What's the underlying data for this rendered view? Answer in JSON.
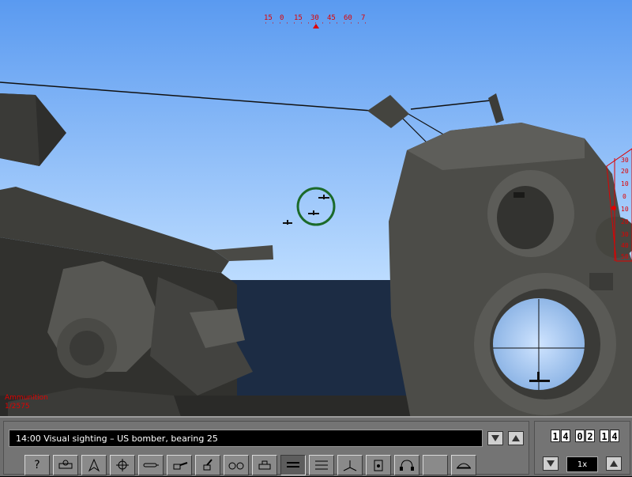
{
  "hud": {
    "compass_labels": [
      "15",
      "0",
      "15",
      "30",
      "45",
      "60",
      "7"
    ],
    "elevation_labels": [
      "30",
      "20",
      "10",
      "0",
      "10",
      "20",
      "30",
      "40",
      "50"
    ],
    "ammo_label": "Ammunition",
    "ammo_count": "1/2575"
  },
  "message_bar": {
    "text": "14:00  Visual sighting – US bomber, bearing 25"
  },
  "toolbar": {
    "items": [
      {
        "icon": "help-icon"
      },
      {
        "icon": "deck-gun-station-icon"
      },
      {
        "icon": "navigation-icon"
      },
      {
        "icon": "damage-control-icon"
      },
      {
        "icon": "torpedo-icon"
      },
      {
        "icon": "deck-gun-icon"
      },
      {
        "icon": "flak-gun-icon"
      },
      {
        "icon": "binoculars-icon"
      },
      {
        "icon": "bridge-icon"
      },
      {
        "icon": "periscope-station-icon"
      },
      {
        "icon": "attack-map-icon"
      },
      {
        "icon": "axis-icon"
      },
      {
        "icon": "radio-icon"
      },
      {
        "icon": "hydrophone-icon"
      },
      {
        "icon": "blank-icon"
      },
      {
        "icon": "captain-cap-icon"
      }
    ],
    "help_glyph": "?"
  },
  "clock": {
    "h1": "1",
    "h2": "4",
    "m1": "0",
    "m2": "2",
    "s1": "1",
    "s2": "4"
  },
  "time_compression": "1x",
  "colors": {
    "sky_top": "#5a9af0",
    "sky_bottom": "#b9dbff",
    "sea": "#1c2c44",
    "gun_gray": "#4a4a46",
    "hud_red": "#e00000",
    "sight_ring": "#1b6a2a"
  }
}
